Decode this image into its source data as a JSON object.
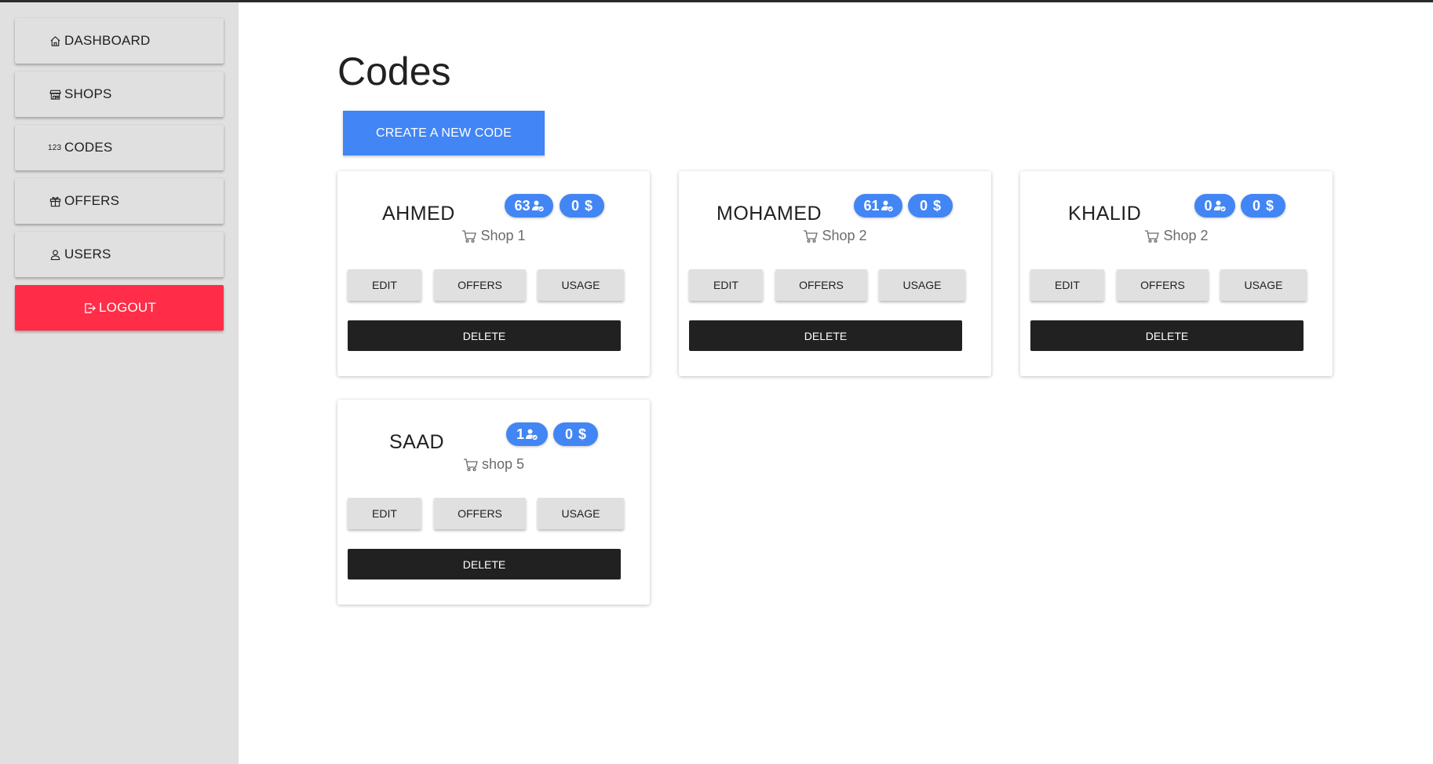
{
  "sidebar": {
    "items": [
      {
        "label": "DASHBOARD",
        "icon": "home-icon"
      },
      {
        "label": "SHOPS",
        "icon": "store-icon"
      },
      {
        "label": "CODES",
        "icon": "numbers-icon",
        "icon_text": "123"
      },
      {
        "label": "OFFERS",
        "icon": "gift-icon"
      },
      {
        "label": "USERS",
        "icon": "user-icon"
      }
    ],
    "logout": {
      "label": "LOGOUT",
      "icon": "logout-icon",
      "color": "#ff2d48"
    }
  },
  "main": {
    "title": "Codes",
    "create_label": "CREATE A NEW CODE",
    "accent_color": "#4285f4"
  },
  "cards": [
    {
      "name": "AHMED",
      "users": "63",
      "amount": "0",
      "currency": "$",
      "shop": "Shop 1",
      "edit": "EDIT",
      "offers": "OFFERS",
      "usage": "USAGE",
      "delete": "DELETE"
    },
    {
      "name": "MOHAMED",
      "users": "61",
      "amount": "0",
      "currency": "$",
      "shop": "Shop 2",
      "edit": "EDIT",
      "offers": "OFFERS",
      "usage": "USAGE",
      "delete": "DELETE"
    },
    {
      "name": "KHALID",
      "users": "0",
      "amount": "0",
      "currency": "$",
      "shop": "Shop 2",
      "edit": "EDIT",
      "offers": "OFFERS",
      "usage": "USAGE",
      "delete": "DELETE"
    },
    {
      "name": "SAAD",
      "users": "1",
      "amount": "0",
      "currency": "$",
      "shop": "shop 5",
      "edit": "EDIT",
      "offers": "OFFERS",
      "usage": "USAGE",
      "delete": "DELETE"
    }
  ]
}
